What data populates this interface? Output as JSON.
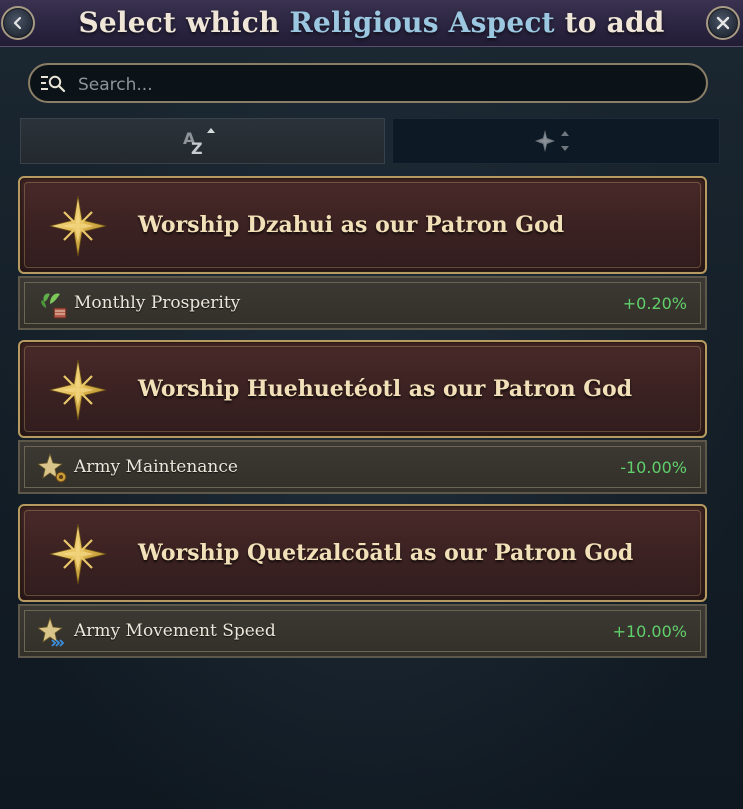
{
  "header": {
    "title_prefix": "Select which ",
    "title_accent": "Religious Aspect",
    "title_suffix": " to add"
  },
  "search": {
    "placeholder": "Search..."
  },
  "sort_tabs": [
    {
      "name": "alphabetical",
      "icon": "sort-az-icon"
    },
    {
      "name": "by-type",
      "icon": "star-sort-icon"
    }
  ],
  "aspects": [
    {
      "title": "Worship Dzahui as our Patron God",
      "effect_label": "Monthly Prosperity",
      "effect_value": "+0.20%",
      "effect_icon": "prosperity-icon"
    },
    {
      "title": "Worship Huehuetéotl as our Patron God",
      "effect_label": "Army Maintenance",
      "effect_value": "-10.00%",
      "effect_icon": "army-maintenance-icon"
    },
    {
      "title": "Worship Quetzalcōātl as our Patron God",
      "effect_label": "Army Movement Speed",
      "effect_value": "+10.00%",
      "effect_icon": "army-movement-icon"
    }
  ],
  "colors": {
    "accent": "#9cc7e0",
    "positive": "#5fd06a",
    "gold": "#b69a62"
  }
}
